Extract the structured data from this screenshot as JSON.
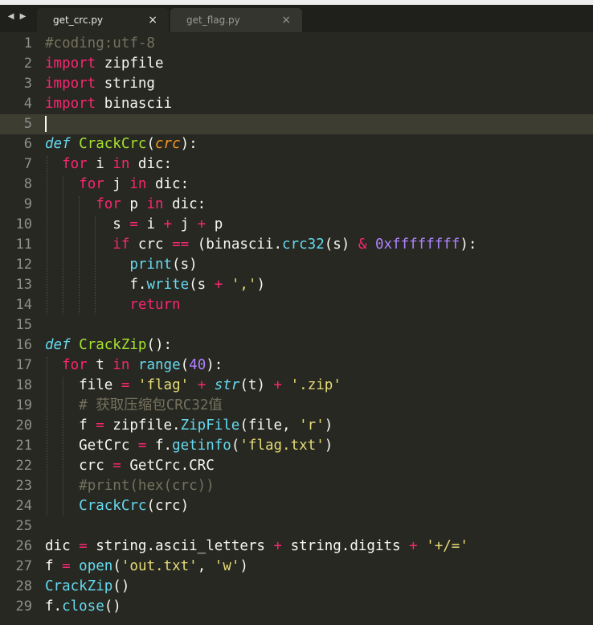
{
  "tabs": [
    {
      "label": "get_crc.py",
      "close": "×",
      "active": true
    },
    {
      "label": "get_flag.py",
      "close": "×",
      "active": false
    }
  ],
  "nav_arrows": "◀ ▶",
  "current_line": 5,
  "lines": [
    [
      [
        "cm",
        "#coding:utf-8"
      ]
    ],
    [
      [
        "kw",
        "import"
      ],
      [
        "tx",
        " zipfile"
      ]
    ],
    [
      [
        "kw",
        "import"
      ],
      [
        "tx",
        " string"
      ]
    ],
    [
      [
        "kw",
        "import"
      ],
      [
        "tx",
        " binascii"
      ]
    ],
    [],
    [
      [
        "df",
        "def"
      ],
      [
        "tx",
        " "
      ],
      [
        "fn",
        "CrackCrc"
      ],
      [
        "tx",
        "("
      ],
      [
        "pa",
        "crc"
      ],
      [
        "tx",
        "):"
      ]
    ],
    [
      [
        "tx",
        "  "
      ],
      [
        "kw",
        "for"
      ],
      [
        "tx",
        " i "
      ],
      [
        "kw",
        "in"
      ],
      [
        "tx",
        " dic:"
      ]
    ],
    [
      [
        "tx",
        "    "
      ],
      [
        "kw",
        "for"
      ],
      [
        "tx",
        " j "
      ],
      [
        "kw",
        "in"
      ],
      [
        "tx",
        " dic:"
      ]
    ],
    [
      [
        "tx",
        "      "
      ],
      [
        "kw",
        "for"
      ],
      [
        "tx",
        " p "
      ],
      [
        "kw",
        "in"
      ],
      [
        "tx",
        " dic:"
      ]
    ],
    [
      [
        "tx",
        "        s "
      ],
      [
        "kw",
        "="
      ],
      [
        "tx",
        " i "
      ],
      [
        "kw",
        "+"
      ],
      [
        "tx",
        " j "
      ],
      [
        "kw",
        "+"
      ],
      [
        "tx",
        " p"
      ]
    ],
    [
      [
        "tx",
        "        "
      ],
      [
        "kw",
        "if"
      ],
      [
        "tx",
        " crc "
      ],
      [
        "kw",
        "=="
      ],
      [
        "tx",
        " (binascii."
      ],
      [
        "bi",
        "crc32"
      ],
      [
        "tx",
        "(s) "
      ],
      [
        "kw",
        "&"
      ],
      [
        "tx",
        " "
      ],
      [
        "nm",
        "0xffffffff"
      ],
      [
        "tx",
        "):"
      ]
    ],
    [
      [
        "tx",
        "          "
      ],
      [
        "bi",
        "print"
      ],
      [
        "tx",
        "(s)"
      ]
    ],
    [
      [
        "tx",
        "          f."
      ],
      [
        "bi",
        "write"
      ],
      [
        "tx",
        "(s "
      ],
      [
        "kw",
        "+"
      ],
      [
        "tx",
        " "
      ],
      [
        "st",
        "','"
      ],
      [
        "tx",
        ")"
      ]
    ],
    [
      [
        "tx",
        "          "
      ],
      [
        "kw",
        "return"
      ]
    ],
    [],
    [
      [
        "df",
        "def"
      ],
      [
        "tx",
        " "
      ],
      [
        "fn",
        "CrackZip"
      ],
      [
        "tx",
        "():"
      ]
    ],
    [
      [
        "tx",
        "  "
      ],
      [
        "kw",
        "for"
      ],
      [
        "tx",
        " t "
      ],
      [
        "kw",
        "in"
      ],
      [
        "tx",
        " "
      ],
      [
        "bi",
        "range"
      ],
      [
        "tx",
        "("
      ],
      [
        "nm",
        "40"
      ],
      [
        "tx",
        "):"
      ]
    ],
    [
      [
        "tx",
        "    file "
      ],
      [
        "kw",
        "="
      ],
      [
        "tx",
        " "
      ],
      [
        "st",
        "'flag'"
      ],
      [
        "tx",
        " "
      ],
      [
        "kw",
        "+"
      ],
      [
        "tx",
        " "
      ],
      [
        "it",
        "str"
      ],
      [
        "tx",
        "(t) "
      ],
      [
        "kw",
        "+"
      ],
      [
        "tx",
        " "
      ],
      [
        "st",
        "'.zip'"
      ]
    ],
    [
      [
        "tx",
        "    "
      ],
      [
        "cm",
        "# 获取压缩包CRC32值"
      ]
    ],
    [
      [
        "tx",
        "    f "
      ],
      [
        "kw",
        "="
      ],
      [
        "tx",
        " zipfile."
      ],
      [
        "bi",
        "ZipFile"
      ],
      [
        "tx",
        "(file, "
      ],
      [
        "st",
        "'r'"
      ],
      [
        "tx",
        ")"
      ]
    ],
    [
      [
        "tx",
        "    GetCrc "
      ],
      [
        "kw",
        "="
      ],
      [
        "tx",
        " f."
      ],
      [
        "bi",
        "getinfo"
      ],
      [
        "tx",
        "("
      ],
      [
        "st",
        "'flag.txt'"
      ],
      [
        "tx",
        ")"
      ]
    ],
    [
      [
        "tx",
        "    crc "
      ],
      [
        "kw",
        "="
      ],
      [
        "tx",
        " GetCrc.CRC"
      ]
    ],
    [
      [
        "tx",
        "    "
      ],
      [
        "cm",
        "#print(hex(crc))"
      ]
    ],
    [
      [
        "tx",
        "    "
      ],
      [
        "bi",
        "CrackCrc"
      ],
      [
        "tx",
        "(crc)"
      ]
    ],
    [],
    [
      [
        "tx",
        "dic "
      ],
      [
        "kw",
        "="
      ],
      [
        "tx",
        " string.ascii_letters "
      ],
      [
        "kw",
        "+"
      ],
      [
        "tx",
        " string.digits "
      ],
      [
        "kw",
        "+"
      ],
      [
        "tx",
        " "
      ],
      [
        "st",
        "'+/='"
      ]
    ],
    [
      [
        "tx",
        "f "
      ],
      [
        "kw",
        "="
      ],
      [
        "tx",
        " "
      ],
      [
        "bi",
        "open"
      ],
      [
        "tx",
        "("
      ],
      [
        "st",
        "'out.txt'"
      ],
      [
        "tx",
        ", "
      ],
      [
        "st",
        "'w'"
      ],
      [
        "tx",
        ")"
      ]
    ],
    [
      [
        "bi",
        "CrackZip"
      ],
      [
        "tx",
        "()"
      ]
    ],
    [
      [
        "tx",
        "f."
      ],
      [
        "bi",
        "close"
      ],
      [
        "tx",
        "()"
      ]
    ]
  ],
  "colors": {
    "background": "#272822",
    "comment": "#75715e",
    "keyword": "#f92672",
    "function_name": "#a6e22e",
    "string": "#e6db74",
    "number": "#ae81ff",
    "builtin": "#66d9ef",
    "parameter": "#fd971f",
    "text": "#f8f8f2"
  }
}
